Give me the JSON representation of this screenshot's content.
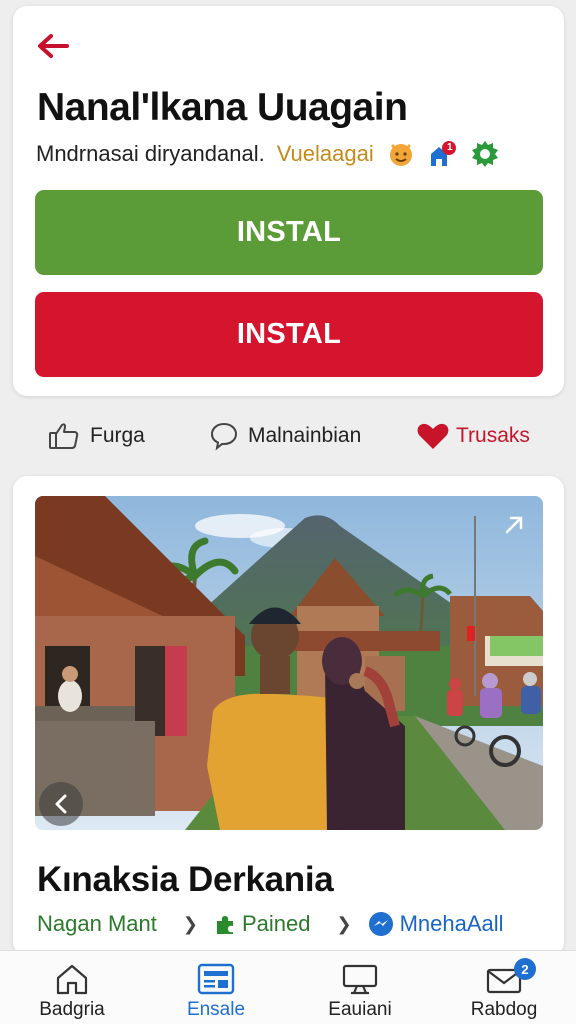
{
  "header": {
    "title": "Nanal'lkana Uuagain",
    "subtitle": "Mndrnasai diryandanal.",
    "tag": "Vuelaagai",
    "notification_count": "1"
  },
  "buttons": {
    "primary_label": "INSTAL",
    "secondary_label": "INSTAL"
  },
  "actions": [
    {
      "label": "Furga",
      "icon": "thumbs-up-icon"
    },
    {
      "label": "Malnainbian",
      "icon": "comment-icon"
    },
    {
      "label": "Trusaks",
      "icon": "heart-icon"
    }
  ],
  "post": {
    "title": "Kınaksia Derkania",
    "breadcrumbs": [
      "Nagan Mant",
      "Pained",
      "MnehaAall"
    ]
  },
  "tabbar": {
    "tabs": [
      {
        "label": "Badgria",
        "icon": "home-icon"
      },
      {
        "label": "Ensale",
        "icon": "news-icon"
      },
      {
        "label": "Eauiani",
        "icon": "monitor-icon"
      },
      {
        "label": "Rabdog",
        "icon": "mail-icon",
        "badge": "2"
      }
    ],
    "active_index": 1
  },
  "colors": {
    "green": "#5c9c38",
    "red": "#d5152e",
    "accent_blue": "#1e6fd0",
    "tag_gold": "#c58a1c"
  }
}
